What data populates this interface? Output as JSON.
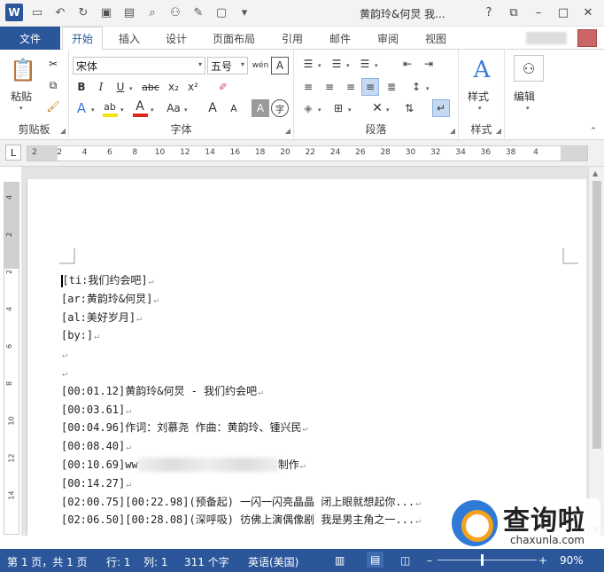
{
  "app": {
    "logo_letter": "W",
    "window_title": "黄韵玲&何炅 我...",
    "win_help": "?",
    "win_restore": "⧉",
    "win_minimize": "–",
    "win_maximize": "□",
    "win_close": "✕"
  },
  "tabs": {
    "file": "文件",
    "items": [
      "开始",
      "插入",
      "设计",
      "页面布局",
      "引用",
      "邮件",
      "审阅",
      "视图"
    ],
    "active_index": 0
  },
  "ribbon": {
    "clipboard": {
      "paste": "粘贴",
      "label": "剪贴板"
    },
    "font": {
      "name": "宋体",
      "size": "五号",
      "pinyin": "wén",
      "border_char": "A",
      "bold": "B",
      "italic": "I",
      "underline": "U",
      "strikethrough": "abc",
      "subscript": "x₂",
      "superscript": "x²",
      "text_effect": "A",
      "highlight": "ab",
      "font_color": "A",
      "change_case": "Aa",
      "grow": "A",
      "shrink": "A",
      "char_shading": "A",
      "enclose": "字",
      "label": "字体",
      "highlight_color": "#f4e30b",
      "font_color_value": "#e0261b"
    },
    "paragraph": {
      "label": "段落"
    },
    "styles": {
      "big": "样式",
      "label": "样式"
    },
    "editing": {
      "big": "编辑"
    }
  },
  "ruler": {
    "corner": "L",
    "h_numbers": [
      "2",
      "2",
      "4",
      "6",
      "8",
      "10",
      "12",
      "14",
      "16",
      "18",
      "20",
      "22",
      "24",
      "26",
      "28",
      "30",
      "32",
      "34",
      "36",
      "38",
      "4"
    ],
    "v_numbers": [
      "4",
      "2",
      "2",
      "4",
      "6",
      "8",
      "10",
      "12",
      "14"
    ]
  },
  "document": {
    "lines": [
      "[ti:我们约会吧]",
      "[ar:黄韵玲&何炅]",
      "[al:美好岁月]",
      "[by:]",
      "",
      "",
      "[00:01.12]黄韵玲&何炅 - 我们约会吧",
      "[00:03.61]",
      "[00:04.96]作词：刘慕尧    作曲：黄韵玲、锺兴民",
      "[00:08.40]",
      "[00:10.69]ww",
      "[00:14.27]",
      "[02:00.75][00:22.98](预备起) 一闪一闪亮晶晶 闭上眼就想起你...",
      "[02:06.50][00:28.08](深呼吸) 彷佛上演偶像剧 我是男主角之一..."
    ],
    "line11_tail": "制作",
    "paragraph_mark": "↵"
  },
  "watermark": {
    "text": "查询啦",
    "url": "chaxunla.com"
  },
  "status": {
    "page": "第 1 页，共 1 页",
    "row": "行: 1",
    "col": "列: 1",
    "words": "311 个字",
    "lang": "英语(美国)",
    "zoom_minus": "–",
    "zoom_plus": "+",
    "zoom": "90%",
    "zoom_level": 0.45
  },
  "colors": {
    "word_blue": "#2b579a",
    "status_bg": "#2b579a"
  }
}
